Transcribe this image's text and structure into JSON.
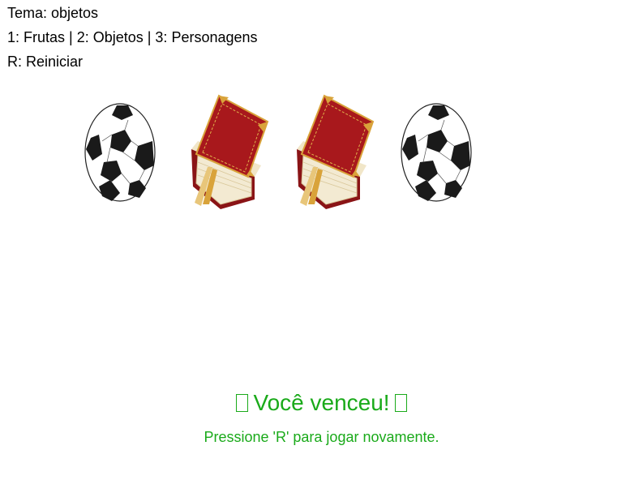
{
  "hud": {
    "theme": "Tema: objetos",
    "keys": "1: Frutas | 2: Objetos | 3: Personagens",
    "restart": "R: Reiniciar"
  },
  "cards": [
    {
      "icon": "soccer-ball-icon"
    },
    {
      "icon": "red-book-icon"
    },
    {
      "icon": "red-book-icon"
    },
    {
      "icon": "soccer-ball-icon"
    }
  ],
  "win": {
    "title": "Você venceu!",
    "subtitle": "Pressione 'R' para jogar novamente."
  },
  "colors": {
    "win_text": "#1aaa1a",
    "book_red": "#a8181c",
    "book_gold": "#d9a33a",
    "ball_black": "#1a1a1a"
  }
}
